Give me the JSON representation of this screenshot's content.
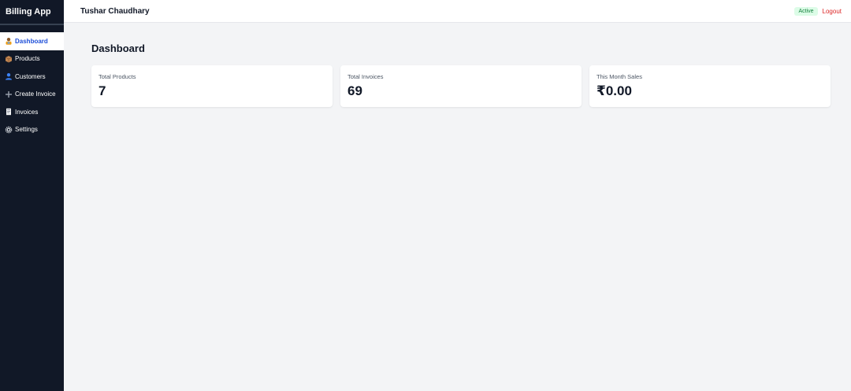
{
  "sidebar": {
    "brand": "Billing App",
    "items": [
      {
        "label": "Dashboard",
        "icon": "dashboard-icon"
      },
      {
        "label": "Products",
        "icon": "box-icon"
      },
      {
        "label": "Customers",
        "icon": "user-icon"
      },
      {
        "label": "Create Invoice",
        "icon": "plus-icon"
      },
      {
        "label": "Invoices",
        "icon": "receipt-icon"
      },
      {
        "label": "Settings",
        "icon": "gear-icon"
      }
    ]
  },
  "header": {
    "username": "Tushar Chaudhary",
    "status_badge": "Active",
    "logout_label": "Logout"
  },
  "main": {
    "title": "Dashboard",
    "cards": [
      {
        "label": "Total Products",
        "value": "7"
      },
      {
        "label": "Total Invoices",
        "value": "69"
      },
      {
        "label": "This Month Sales",
        "value": "₹0.00"
      }
    ]
  },
  "colors": {
    "sidebar_bg": "#111827",
    "accent": "#1d4ed8",
    "status_green": "#15803d",
    "logout_red": "#dc2626",
    "page_bg": "#f3f4f6"
  }
}
